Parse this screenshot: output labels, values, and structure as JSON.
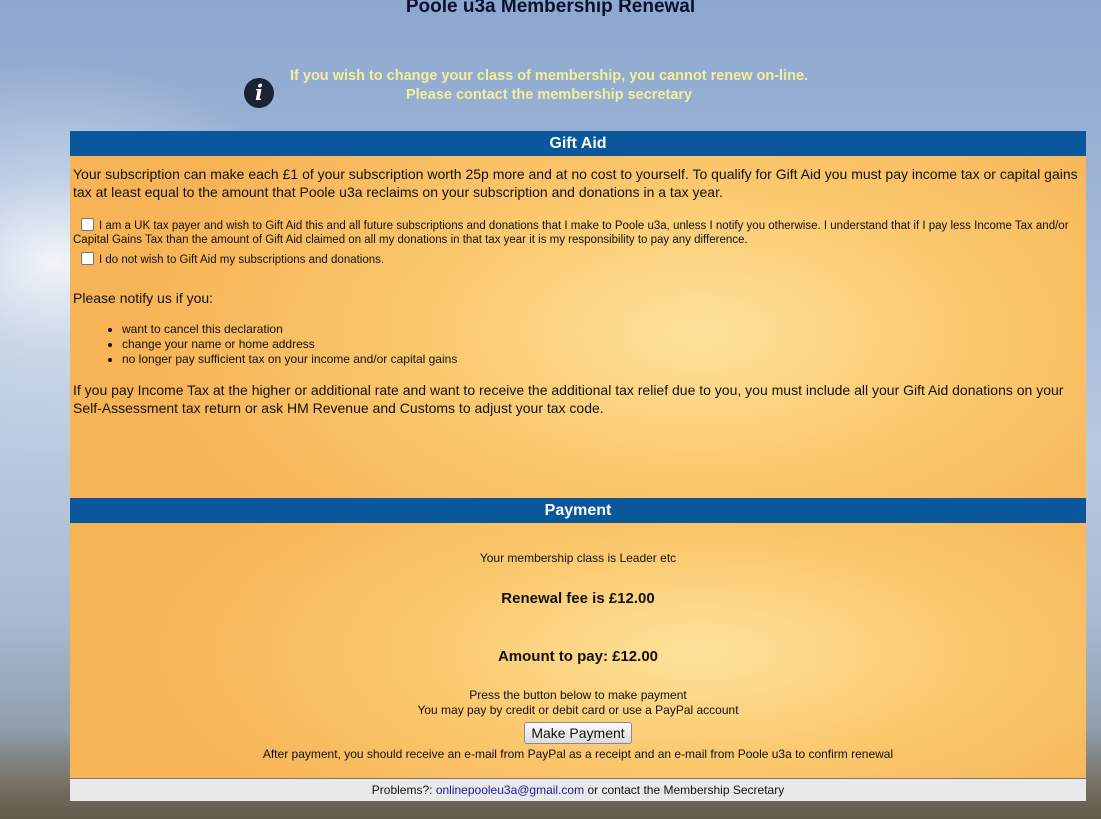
{
  "page": {
    "title": "Poole u3a Membership Renewal",
    "notice_line1": "If you wish to change your class of membership, you cannot renew on-line.",
    "notice_line2": "Please contact the membership secretary"
  },
  "gift_aid": {
    "header": "Gift Aid",
    "intro": "Your subscription can make each £1 of your subscription worth 25p more and at no cost to yourself. To qualify for Gift Aid you must pay income tax or capital gains tax at least equal to the amount that Poole u3a reclaims on your subscription and donations in a tax year.",
    "option_yes": "I am a UK tax payer and wish to Gift Aid this and all future subscriptions and donations that I make to Poole u3a, unless I notify you otherwise. I understand that if I pay less Income Tax and/or Capital Gains Tax than the amount of Gift Aid claimed on all my donations in that tax year it is my responsibility to pay any difference.",
    "option_yes_checked": false,
    "option_no": "I do not wish to Gift Aid my subscriptions and donations.",
    "option_no_checked": false,
    "notify_heading": "Please notify us if you:",
    "notify_items": [
      "want to cancel this declaration",
      "change your name or home address",
      "no longer pay sufficient tax on your income and/or capital gains"
    ],
    "higher_rate_text": "If you pay Income Tax at the higher or additional rate and want to receive the additional tax relief due to you, you must include all your Gift Aid donations on your Self-Assessment tax return or ask HM Revenue and Customs to adjust your tax code."
  },
  "payment": {
    "header": "Payment",
    "membership_class": "Your membership class is Leader etc",
    "renewal_fee": "Renewal fee is £12.00",
    "amount_to_pay": "Amount to pay: £12.00",
    "instruction_line1": "Press the button below to make payment",
    "instruction_line2": "You may pay by credit or debit card or use a PayPal account",
    "button_label": "Make Payment",
    "after_payment": "After payment, you should receive an e-mail from PayPal as a receipt and an e-mail from Poole u3a to confirm renewal"
  },
  "footer": {
    "prefix": "Problems?: ",
    "email": "onlinepooleu3a@gmail.com",
    "suffix": " or contact the Membership Secretary"
  },
  "colors": {
    "header_bar": "#0a579c",
    "notice_text": "#f4ef9a",
    "panel": "#fbc86d",
    "link": "#1a1aa6",
    "footer_bg": "#e9e9ea"
  },
  "icons": {
    "notice": "info-icon"
  }
}
